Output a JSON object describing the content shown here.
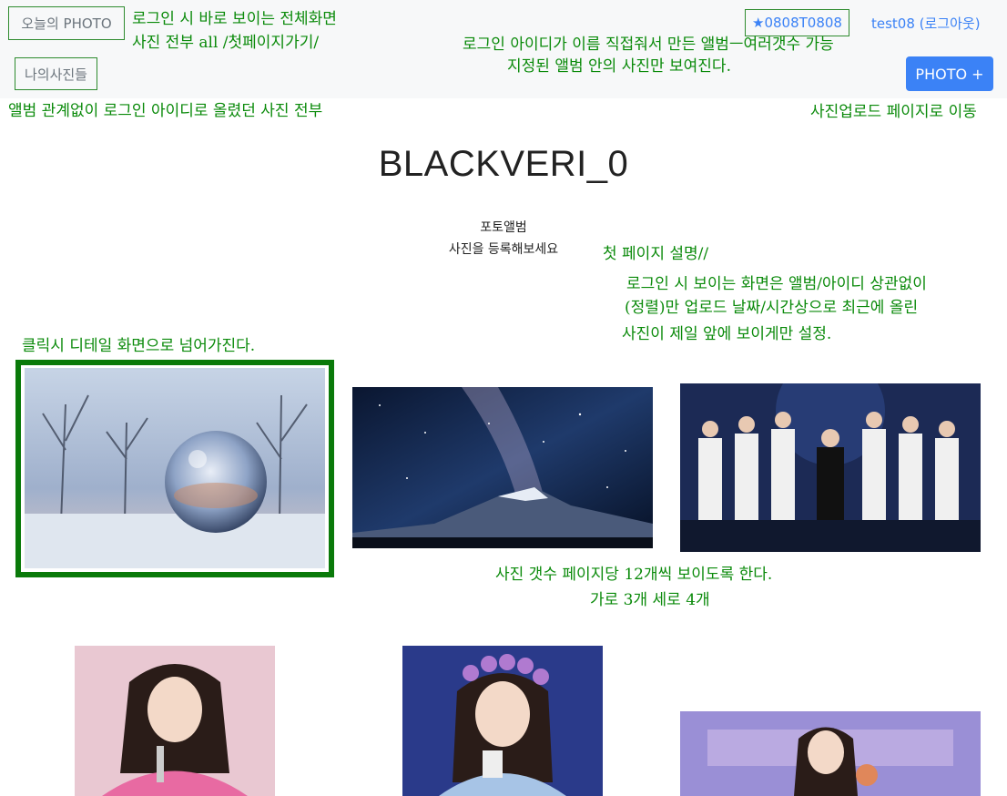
{
  "nav": {
    "today_photo": "오늘의 PHOTO",
    "my_photos": "나의사진들",
    "album": "★0808T0808",
    "user_logout": "test08 (로그아웃)",
    "photo_plus": "PHOTO +"
  },
  "notes": {
    "n1_line1": "로그인 시 바로 보이는 전체화면",
    "n1_line2": "사진 전부 all /첫페이지가기/",
    "n2_line1": "로그인 아이디가 이름 직접줘서 만든 앨범ㅡ여러갯수 가능",
    "n2_line2": "지정된 앨범 안의 사진만 보여진다.",
    "n3": "앨범 관계없이 로그인 아이디로 올렸던 사진 전부",
    "n4": "사진업로드 페이지로 이동",
    "n5_title": "첫 페이지 설명//",
    "n5_line1": "로그인 시 보이는 화면은 앨범/아이디 상관없이",
    "n5_line2": "(정렬)만 업로드 날짜/시간상으로 최근에 올린",
    "n5_line3": "사진이 제일 앞에 보이게만 설정.",
    "n6": "클릭시 디테일 화면으로 넘어가진다.",
    "n7_line1": "사진 갯수 페이지당 12개씩 보이도록 한다.",
    "n7_line2": "가로 3개 세로 4개"
  },
  "header": {
    "title": "BLACKVERI_0",
    "subtitle1": "포토앨범",
    "subtitle2": "사진을 등록해보세요"
  },
  "photos": [
    {
      "name": "crystal-ball-snow"
    },
    {
      "name": "milky-way-mountain"
    },
    {
      "name": "stage-group-performance"
    },
    {
      "name": "singer-pink-outfit"
    },
    {
      "name": "singer-flower-crown"
    },
    {
      "name": "singer-spring-stage"
    }
  ],
  "colors": {
    "annotation": "#0a8a0a",
    "link": "#3b82f6",
    "primary_button": "#3b82f6",
    "topbar": "#f7f8f9"
  }
}
